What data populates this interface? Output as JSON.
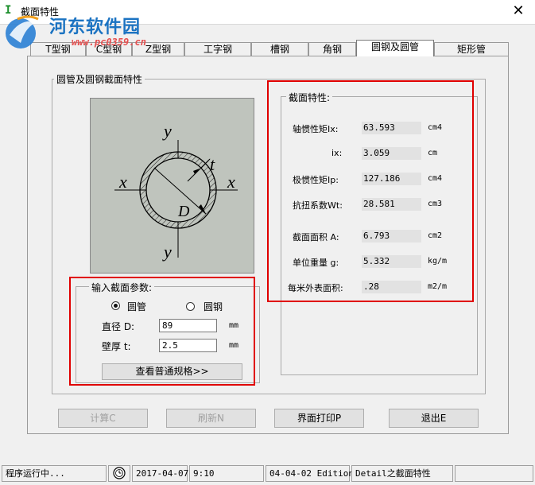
{
  "window": {
    "title": "截面特性",
    "close_glyph": "✕"
  },
  "watermark": {
    "text": "河东软件园",
    "url": "www.pc0359.cn"
  },
  "tabs": [
    {
      "label": "T型钢"
    },
    {
      "label": "C型钢"
    },
    {
      "label": "Z型钢"
    },
    {
      "label": "工字钢"
    },
    {
      "label": "槽钢"
    },
    {
      "label": "角钢"
    },
    {
      "label": "圆钢及圆管",
      "active": true
    },
    {
      "label": "矩形管"
    }
  ],
  "main_group": {
    "title": "圆管及圆钢截面特性"
  },
  "diagram": {
    "y_top": "y",
    "y_bottom": "y",
    "x_left": "x",
    "x_right": "x",
    "t": "t",
    "D": "D"
  },
  "input": {
    "title": "输入截面参数:",
    "radio_tube": "圆管",
    "radio_bar": "圆钢",
    "selected": "tube",
    "diameter_label": "直径 D:",
    "diameter_value": "89",
    "diameter_unit": "mm",
    "thickness_label": "壁厚 t:",
    "thickness_value": "2.5",
    "thickness_unit": "mm",
    "view_spec_button": "查看普通规格>>"
  },
  "properties": {
    "title": "截面特性:",
    "rows": [
      {
        "label": "轴惯性矩Ix:",
        "value": "63.593",
        "unit": "cm4"
      },
      {
        "label": "ix:",
        "value": "3.059",
        "unit": "cm"
      },
      {
        "label": "极惯性矩Ip:",
        "value": "127.186",
        "unit": "cm4"
      },
      {
        "label": "抗扭系数Wt:",
        "value": "28.581",
        "unit": "cm3"
      },
      {
        "label": "截面面积 A:",
        "value": "6.793",
        "unit": "cm2"
      },
      {
        "label": "单位重量 g:",
        "value": "5.332",
        "unit": "kg/m"
      },
      {
        "label": "每米外表面积:",
        "value": ".28",
        "unit": "m2/m"
      }
    ]
  },
  "buttons": {
    "calc": "计算C",
    "refresh": "刷新N",
    "print": "界面打印P",
    "exit": "退出E"
  },
  "status": {
    "state": "程序运行中...",
    "date": "2017-04-07",
    "time": "9:10",
    "edition": "04-04-02 Edition",
    "detail": "Detail之截面特性"
  },
  "colors": {
    "highlight_box": "#e00000",
    "diagram_bg": "#bfc4bd",
    "watermark_blue": "#1b73c2"
  }
}
